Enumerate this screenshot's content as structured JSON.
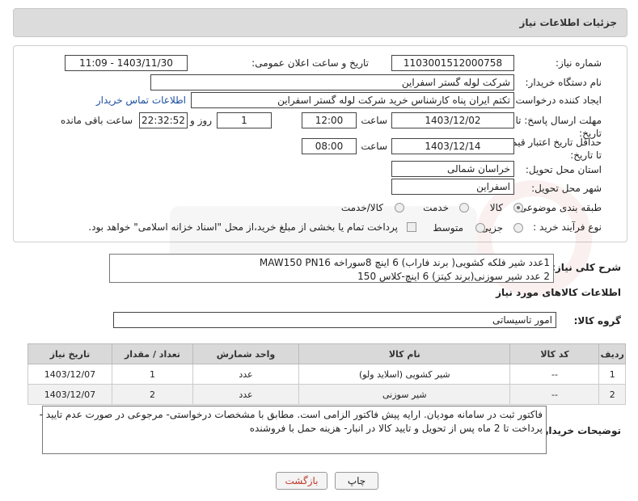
{
  "header": {
    "title": "جزئیات اطلاعات نیاز"
  },
  "fields": {
    "need_number_label": "شماره نیاز:",
    "need_number": "1103001512000758",
    "announce_label": "تاریخ و ساعت اعلان عمومی:",
    "announce_value": "1403/11/30 - 11:09",
    "buyer_org_label": "نام دستگاه خریدار:",
    "buyer_org": "شرکت لوله گستر اسفراین",
    "requester_label": "ایجاد کننده درخواست:",
    "requester": "تکتم ایران پناه کارشناس خرید شرکت لوله گستر اسفراین",
    "contact_link": "اطلاعات تماس خریدار",
    "reply_deadline_label": "مهلت ارسال پاسخ: تا تاریخ:",
    "reply_date": "1403/12/02",
    "time_label": "ساعت",
    "reply_time": "12:00",
    "days_value": "1",
    "days_label": "روز و",
    "remaining_time": "22:32:52",
    "remaining_label": "ساعت باقی مانده",
    "price_validity_label": "حداقل تاریخ اعتبار قیمت: تا تاریخ:",
    "price_date": "1403/12/14",
    "price_time_label": "ساعت",
    "price_time": "08:00",
    "province_label": "استان محل تحویل:",
    "province": "خراسان شمالی",
    "city_label": "شهر محل تحویل:",
    "city": "اسفراین",
    "category_label": "طبقه بندی موضوعی:",
    "category_options": [
      "کالا",
      "خدمت",
      "کالا/خدمت"
    ],
    "process_label": "نوع فرآیند خرید :",
    "process_options": [
      "جزیی",
      "متوسط"
    ],
    "process_note": "پرداخت تمام یا بخشی از مبلغ خرید،از محل \"اسناد خزانه اسلامی\" خواهد بود."
  },
  "general_desc": {
    "label": "شرح کلی نیاز:",
    "line1": "1عدد شیر فلکه کشویی( برند فاراب) 6 اینچ 8سوراخه MAW150 PN16",
    "line2": "2  عدد شیر سوزنی(برند کیتز) 6 اینچ-کلاس 150"
  },
  "goods_info_title": "اطلاعات کالاهای مورد نیاز",
  "goods_group": {
    "label": "گروه کالا:",
    "value": "امور تاسیساتی"
  },
  "table": {
    "headers": [
      "ردیف",
      "کد کالا",
      "نام کالا",
      "واحد شمارش",
      "تعداد / مقدار",
      "تاریخ نیاز"
    ],
    "rows": [
      [
        "1",
        "--",
        "شیر کشویی (اسلاید ولو)",
        "عدد",
        "1",
        "1403/12/07"
      ],
      [
        "2",
        "--",
        "شیر سوزنی",
        "عدد",
        "2",
        "1403/12/07"
      ]
    ]
  },
  "buyer_notes": {
    "label": "توضیحات خریدار:",
    "line1": "فاکتور ثبت در سامانه مودیان. ارایه پیش فاکتور الزامی است. مطابق با مشخصات درخواستی- مرجوعی در صورت عدم تایید -",
    "line2": "پرداخت تا 2 ماه پس از تحویل و تایید کالا در انبار- هزینه حمل با فروشنده"
  },
  "buttons": {
    "print": "چاپ",
    "back": "بازگشت"
  },
  "colors": {
    "link": "#1a4fa0",
    "header_bg": "#dcdcdc",
    "back_text": "#c0392b"
  }
}
